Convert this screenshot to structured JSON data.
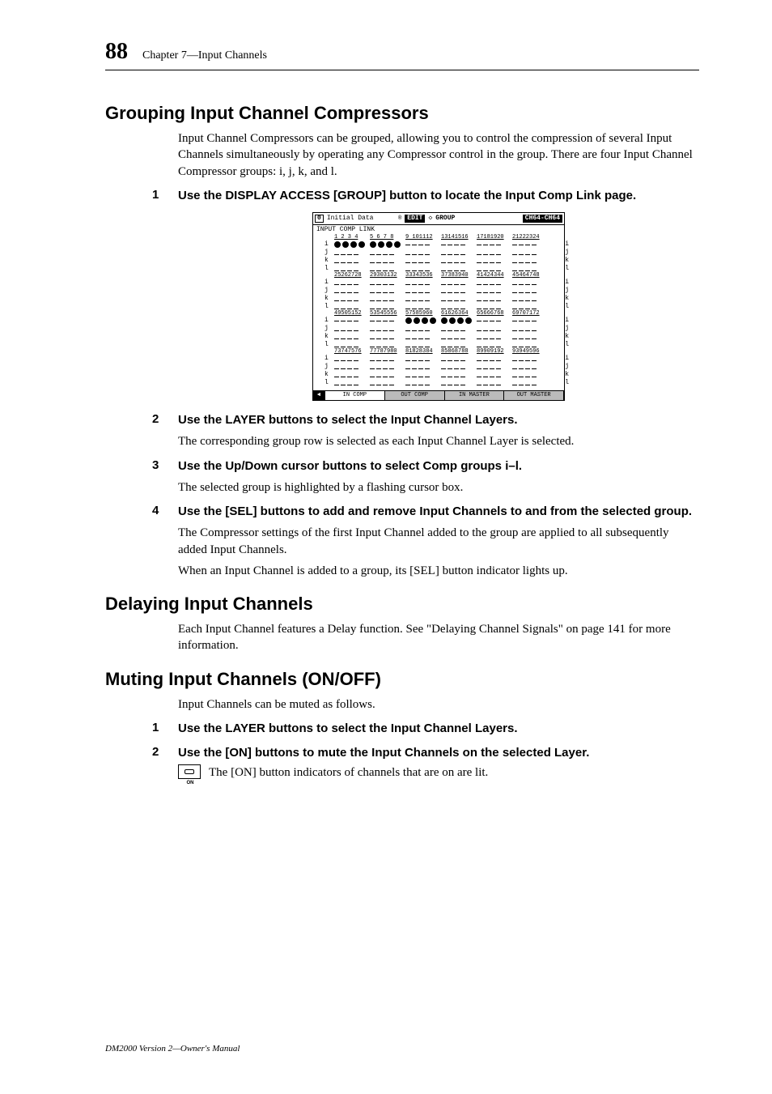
{
  "header": {
    "page_number": "88",
    "chapter": "Chapter 7—Input Channels"
  },
  "section1": {
    "title": "Grouping Input Channel Compressors",
    "intro": "Input Channel Compressors can be grouped, allowing you to control the compression of several Input Channels simultaneously by operating any Compressor control in the group. There are four Input Channel Compressor groups: i, j, k, and l.",
    "step1_num": "1",
    "step1_text": "Use the DISPLAY ACCESS [GROUP] button to locate the Input Comp Link page.",
    "step2_num": "2",
    "step2_text": "Use the LAYER buttons to select the Input Channel Layers.",
    "step2_body": "The corresponding group row is selected as each Input Channel Layer is selected.",
    "step3_num": "3",
    "step3_text": "Use the Up/Down cursor buttons to select Comp groups i–l.",
    "step3_body": "The selected group is highlighted by a flashing cursor box.",
    "step4_num": "4",
    "step4_text": "Use the [SEL] buttons to add and remove Input Channels to and from the selected group.",
    "step4_body1": "The Compressor settings of the first Input Channel added to the group are applied to all subsequently added Input Channels.",
    "step4_body2": "When an Input Channel is added to a group, its [SEL] button indicator lights up."
  },
  "section2": {
    "title": "Delaying Input Channels",
    "body": "Each Input Channel features a Delay function. See \"Delaying Channel Signals\" on page 141 for more information."
  },
  "section3": {
    "title": "Muting Input Channels (ON/OFF)",
    "intro": "Input Channels can be muted as follows.",
    "step1_num": "1",
    "step1_text": "Use the LAYER buttons to select the Input Channel Layers.",
    "step2_num": "2",
    "step2_text": "Use the [ON] buttons to mute the Input Channels on the selected Layer.",
    "step2_body": "The [ON] button indicators of channels that are on are lit.",
    "on_label": "ON"
  },
  "screenshot": {
    "corner": "0",
    "title": "Initial Data",
    "edit": "EDIT",
    "page": "GROUP",
    "channel": "CH64-CH64",
    "section": "INPUT COMP LINK",
    "row_labels": [
      "i",
      "j",
      "k",
      "l"
    ],
    "headers": [
      [
        "1 2 3 4",
        "5 6 7 8",
        "9 101112",
        "13141516",
        "17181920",
        "21222324"
      ],
      [
        "25262728",
        "29303132",
        "33343536",
        "37383940",
        "41424344",
        "45464748"
      ],
      [
        "49505152",
        "53545556",
        "57585960",
        "61626364",
        "65666768",
        "69707172"
      ],
      [
        "73747576",
        "77787980",
        "81828384",
        "85868788",
        "89909192",
        "93949596"
      ]
    ],
    "tabs": {
      "arrow": "◄",
      "t1": "IN COMP",
      "t2": "OUT COMP",
      "t3": "IN MASTER",
      "t4": "OUT MASTER"
    }
  },
  "footer": "DM2000 Version 2—Owner's Manual"
}
